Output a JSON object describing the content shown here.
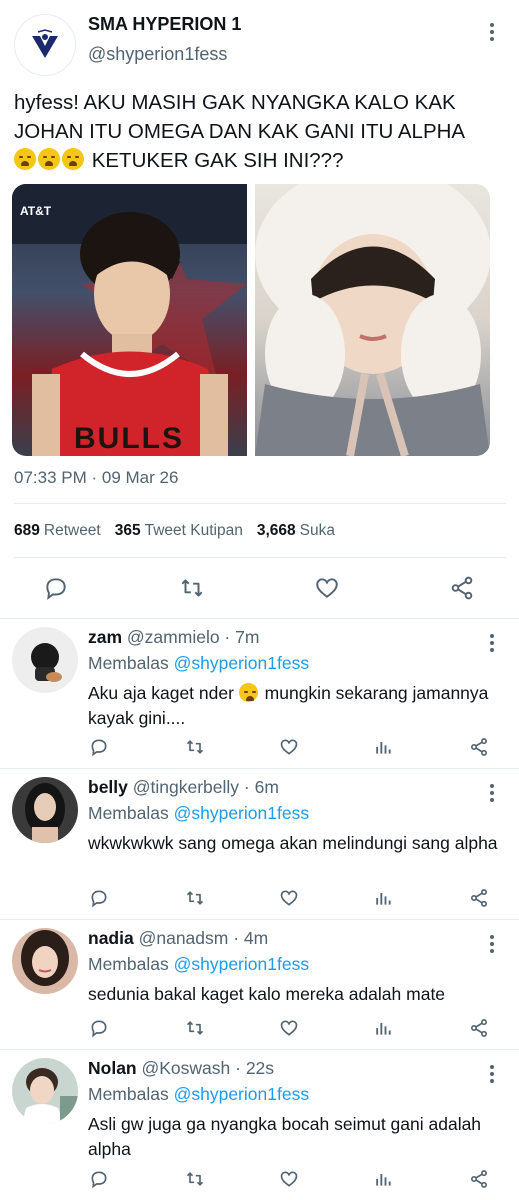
{
  "colors": {
    "text": "#0f1419",
    "muted": "#536471",
    "link": "#1d9bf0",
    "divider": "#e6ecf0"
  },
  "tweet": {
    "author_name": "SMA HYPERION 1",
    "author_handle": "@shyperion1fess",
    "text_line1": "hyfess! AKU MASIH GAK NYANGKA KALO KAK JOHAN ITU OMEGA DAN KAK GANI ITU ALPHA",
    "text_line2": " KETUKER GAK SIH INI???",
    "emoji_icon": "weary-face-emoji",
    "media": {
      "left_photo_text": "AT&T",
      "left_photo_jersey": "BULLS"
    },
    "timestamp": "07:33 PM · 09 Mar 26",
    "stats": {
      "retweets": "689",
      "retweets_label": "Retweet",
      "quotes": "365",
      "quotes_label": "Tweet Kutipan",
      "likes": "3,668",
      "likes_label": "Suka"
    }
  },
  "replies": [
    {
      "name": "zam",
      "handle": "@zammielo · 7m",
      "replying_prefix": "Membalas ",
      "replying_to": "@shyperion1fess",
      "text_a": "Aku aja kaget nder ",
      "text_b": " mungkin sekarang jamannya kayak gini....",
      "emoji": "slightly-smiling-face-emoji"
    },
    {
      "name": "belly",
      "handle": "@tingkerbelly · 6m",
      "replying_prefix": "Membalas ",
      "replying_to": "@shyperion1fess",
      "text_a": "wkwkwkwk sang omega akan melindungi sang alpha",
      "text_b": ""
    },
    {
      "name": "nadia",
      "handle": "@nanadsm · 4m",
      "replying_prefix": "Membalas ",
      "replying_to": "@shyperion1fess",
      "text_a": "sedunia bakal kaget kalo mereka adalah mate",
      "text_b": ""
    },
    {
      "name": "Nolan",
      "handle": "@Koswash · 22s",
      "replying_prefix": "Membalas ",
      "replying_to": "@shyperion1fess",
      "text_a": "Asli gw juga ga nyangka bocah seimut gani adalah alpha",
      "text_b": ""
    }
  ]
}
